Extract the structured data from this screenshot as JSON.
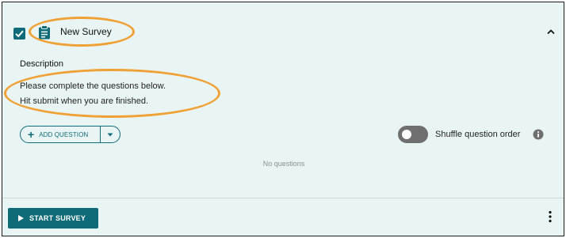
{
  "header": {
    "survey_title": "New Survey",
    "icons": {
      "checkbox": "checkbox-checked-icon",
      "survey": "clipboard-icon",
      "collapse": "chevron-up-icon"
    }
  },
  "description": {
    "label": "Description",
    "line1": "Please complete the questions below.",
    "line2": "Hit submit when you are finished."
  },
  "questions": {
    "add_label": "ADD QUESTION",
    "add_icon": "plus-icon",
    "dropdown_icon": "caret-down-icon",
    "shuffle_label": "Shuffle question order",
    "shuffle_on": false,
    "info_icon": "info-icon",
    "empty_text": "No questions"
  },
  "footer": {
    "start_label": "START SURVEY",
    "start_icon": "play-icon",
    "more_icon": "more-vertical-icon"
  },
  "colors": {
    "accent": "#0f6b77",
    "card_background": "#e9f5f5",
    "highlight": "#f0a135",
    "toggle_off": "#6f6f6f"
  }
}
